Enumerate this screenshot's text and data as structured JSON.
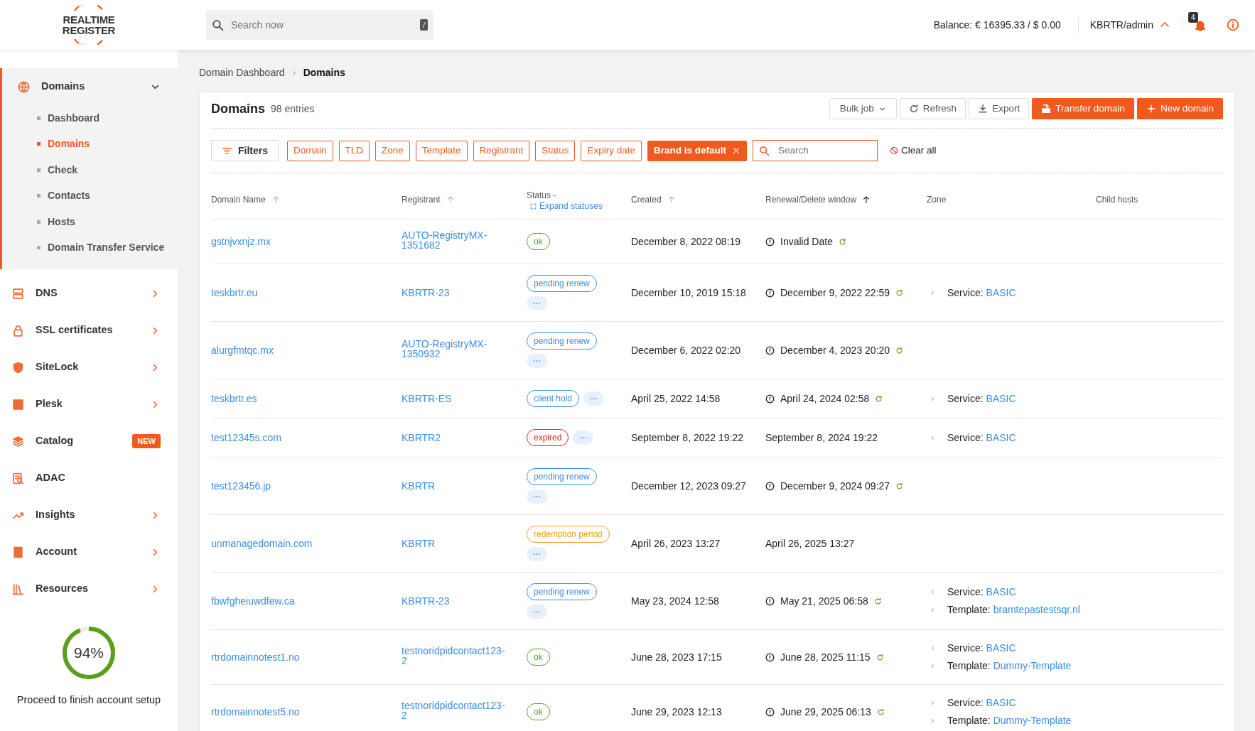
{
  "header": {
    "logo": [
      "REALTIME",
      "REGISTER"
    ],
    "search": {
      "placeholder": "Search now",
      "shortcut": "/"
    },
    "balance": "Balance: € 16395.33 / $ 0.00",
    "user": "KBRTR/admin",
    "notifications": "4"
  },
  "sidebar": {
    "items": [
      {
        "label": "Domains",
        "selected": true,
        "expanded": true,
        "children": [
          {
            "label": "Dashboard",
            "selected": false
          },
          {
            "label": "Domains",
            "selected": true
          },
          {
            "label": "Check",
            "selected": false
          },
          {
            "label": "Contacts",
            "selected": false
          },
          {
            "label": "Hosts",
            "selected": false
          },
          {
            "label": "Domain Transfer Service",
            "selected": false
          }
        ]
      },
      {
        "label": "DNS",
        "selected": false,
        "expanded": false
      },
      {
        "label": "SSL certificates",
        "selected": false,
        "expanded": false
      },
      {
        "label": "SiteLock",
        "selected": false,
        "expanded": false
      },
      {
        "label": "Plesk",
        "selected": false,
        "expanded": false
      },
      {
        "label": "Catalog",
        "selected": false,
        "badge": "NEW"
      },
      {
        "label": "ADAC",
        "selected": false
      },
      {
        "label": "Insights",
        "selected": false,
        "expanded": false
      },
      {
        "label": "Account",
        "selected": false,
        "expanded": false
      },
      {
        "label": "Resources",
        "selected": false,
        "expanded": false
      }
    ],
    "setup": {
      "level": 0.94,
      "reading": "94%",
      "text": "Proceed to finish account setup"
    }
  },
  "breadcrumb": [
    {
      "label": "Domain Dashboard",
      "selected": false
    },
    {
      "label": "Domains",
      "selected": true
    }
  ],
  "panel": {
    "title": "Domains",
    "count": "98 entries",
    "buttons": [
      {
        "label": "Bulk job",
        "kind": "dropdown"
      },
      {
        "label": "Refresh",
        "kind": "refresh"
      },
      {
        "label": "Export",
        "kind": "export"
      },
      {
        "label": "Transfer domain",
        "kind": "transfer"
      },
      {
        "label": "New domain",
        "kind": "new"
      }
    ],
    "filters": {
      "label": "Filters",
      "chips": [
        {
          "label": "Domain",
          "active": false
        },
        {
          "label": "TLD",
          "active": false
        },
        {
          "label": "Zone",
          "active": false
        },
        {
          "label": "Template",
          "active": false
        },
        {
          "label": "Registrant",
          "active": false
        },
        {
          "label": "Status",
          "active": false
        },
        {
          "label": "Expiry date",
          "active": false
        },
        {
          "label": "Brand is default",
          "active": true
        }
      ],
      "search": {
        "placeholder": "Search"
      },
      "clear": "Clear all"
    }
  },
  "table": {
    "columns": [
      {
        "label": "Domain Name",
        "sorted": false
      },
      {
        "label": "Registrant",
        "sorted": false
      },
      {
        "label": "Status -",
        "link": "Expand statuses"
      },
      {
        "label": "Created",
        "sorted": false
      },
      {
        "label": "Renewal/Delete window",
        "sorted": true
      },
      {
        "label": "Zone"
      },
      {
        "label": "Child hosts"
      }
    ],
    "more_label": "···",
    "rows": [
      {
        "domain": "gstnjvxnjz.mx",
        "registrant": "AUTO-RegistryMX-1351682",
        "statuses": [
          {
            "label": "ok",
            "kind": "ok"
          }
        ],
        "more": false,
        "created": "December 8, 2022 08:19",
        "renewal": "Invalid Date",
        "auto_renew": true,
        "zone": []
      },
      {
        "domain": "teskbrtr.eu",
        "registrant": "KBRTR-23",
        "statuses": [
          {
            "label": "pending renew",
            "kind": "info"
          }
        ],
        "more": true,
        "created": "December 10, 2019 15:18",
        "renewal": "December 9, 2022 22:59",
        "auto_renew": true,
        "zone": [
          {
            "label": "Service:",
            "value": "BASIC"
          }
        ]
      },
      {
        "domain": "alurgfmtqc.mx",
        "registrant": "AUTO-RegistryMX-1350932",
        "statuses": [
          {
            "label": "pending renew",
            "kind": "info"
          }
        ],
        "more": true,
        "created": "December 6, 2022 02:20",
        "renewal": "December 4, 2023 20:20",
        "auto_renew": true,
        "zone": []
      },
      {
        "domain": "teskbrtr.es",
        "registrant": "KBRTR-ES",
        "statuses": [
          {
            "label": "client hold",
            "kind": "info"
          }
        ],
        "more": true,
        "created": "April 25, 2022 14:58",
        "renewal": "April 24, 2024 02:58",
        "auto_renew": true,
        "zone": [
          {
            "label": "Service:",
            "value": "BASIC"
          }
        ]
      },
      {
        "domain": "test12345s.com",
        "registrant": "KBRTR2",
        "statuses": [
          {
            "label": "expired",
            "kind": "danger"
          }
        ],
        "more": true,
        "created": "September 8, 2022 19:22",
        "renewal": "September 8, 2024 19:22",
        "auto_renew": false,
        "zone": [
          {
            "label": "Service:",
            "value": "BASIC"
          }
        ]
      },
      {
        "domain": "test123456.jp",
        "registrant": "KBRTR",
        "statuses": [
          {
            "label": "pending renew",
            "kind": "info"
          }
        ],
        "more": true,
        "created": "December 12, 2023 09:27",
        "renewal": "December 9, 2024 09:27",
        "auto_renew": true,
        "zone": []
      },
      {
        "domain": "unmanagedomain.com",
        "registrant": "KBRTR",
        "statuses": [
          {
            "label": "redemption period",
            "kind": "warning"
          }
        ],
        "more": true,
        "created": "April 26, 2023 13:27",
        "renewal": "April 26, 2025 13:27",
        "auto_renew": false,
        "zone": []
      },
      {
        "domain": "fbwfgheiuwdfew.ca",
        "registrant": "KBRTR-23",
        "statuses": [
          {
            "label": "pending renew",
            "kind": "info"
          }
        ],
        "more": true,
        "created": "May 23, 2024 12:58",
        "renewal": "May 21, 2025 06:58",
        "auto_renew": true,
        "zone": [
          {
            "label": "Service:",
            "value": "BASIC"
          },
          {
            "label": "Template:",
            "value": "bramtepastestsqr.nl"
          }
        ]
      },
      {
        "domain": "rtrdomainnotest1.no",
        "registrant": "testnoridpidcontact123-2",
        "statuses": [
          {
            "label": "ok",
            "kind": "ok"
          }
        ],
        "more": false,
        "created": "June 28, 2023 17:15",
        "renewal": "June 28, 2025 11:15",
        "auto_renew": true,
        "zone": [
          {
            "label": "Service:",
            "value": "BASIC"
          },
          {
            "label": "Template:",
            "value": "Dummy-Template"
          }
        ]
      },
      {
        "domain": "rtrdomainnotest5.no",
        "registrant": "testnoridpidcontact123-2",
        "statuses": [
          {
            "label": "ok",
            "kind": "ok"
          }
        ],
        "more": false,
        "created": "June 29, 2023 12:13",
        "renewal": "June 29, 2025 06:13",
        "auto_renew": true,
        "zone": [
          {
            "label": "Service:",
            "value": "BASIC"
          },
          {
            "label": "Template:",
            "value": "Dummy-Template"
          }
        ]
      }
    ]
  }
}
